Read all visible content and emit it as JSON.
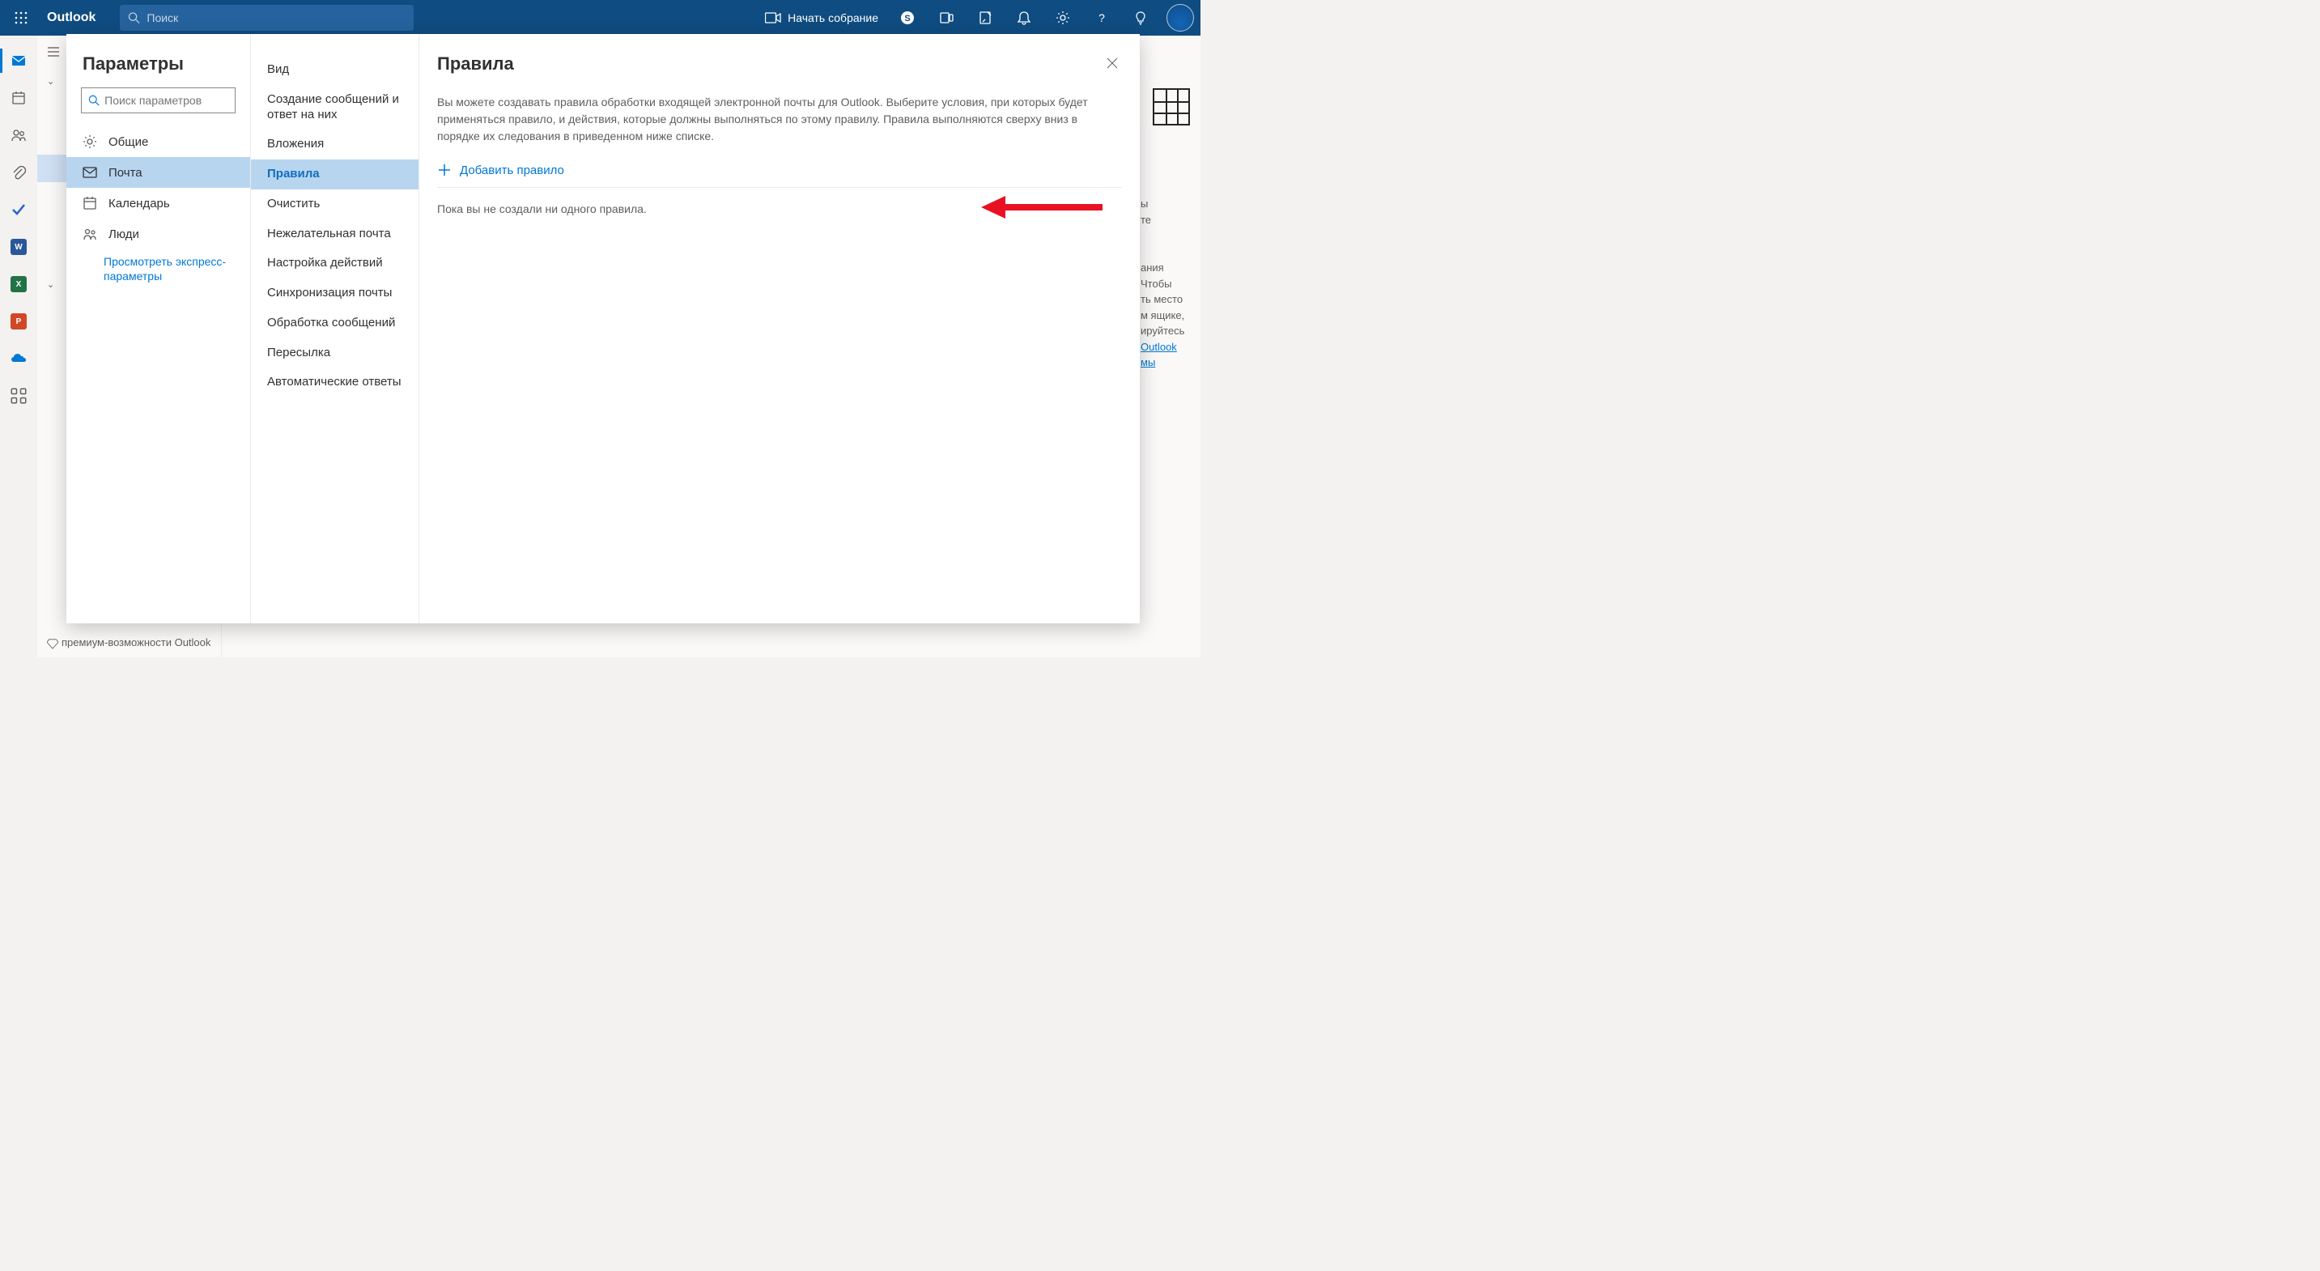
{
  "header": {
    "app_name": "Outlook",
    "search_placeholder": "Поиск",
    "meet_label": "Начать собрание"
  },
  "background": {
    "premium_text": "премиум-возможности Outlook",
    "right_text1": "ы",
    "right_text2": "те",
    "right_text3": "ания",
    "right_text4": "Чтобы",
    "right_text5": "ть место",
    "right_text6": "м ящике,",
    "right_text7": "ируйтесь",
    "right_link1": "Outlook",
    "right_link2": "мы"
  },
  "modal": {
    "title": "Параметры",
    "search_placeholder": "Поиск параметров",
    "categories": [
      {
        "label": "Общие"
      },
      {
        "label": "Почта"
      },
      {
        "label": "Календарь"
      },
      {
        "label": "Люди"
      }
    ],
    "quick_link": "Просмотреть экспресс-параметры",
    "sub_items": [
      "Вид",
      "Создание сообщений и ответ на них",
      "Вложения",
      "Правила",
      "Очистить",
      "Нежелательная почта",
      "Настройка действий",
      "Синхронизация почты",
      "Обработка сообщений",
      "Пересылка",
      "Автоматические ответы"
    ],
    "panel_title": "Правила",
    "panel_desc": "Вы можете создавать правила обработки входящей электронной почты для Outlook. Выберите условия, при которых будет применяться правило, и действия, которые должны выполняться по этому правилу. Правила выполняются сверху вниз в порядке их следования в приведенном ниже списке.",
    "add_rule": "Добавить правило",
    "empty": "Пока вы не создали ни одного правила."
  }
}
